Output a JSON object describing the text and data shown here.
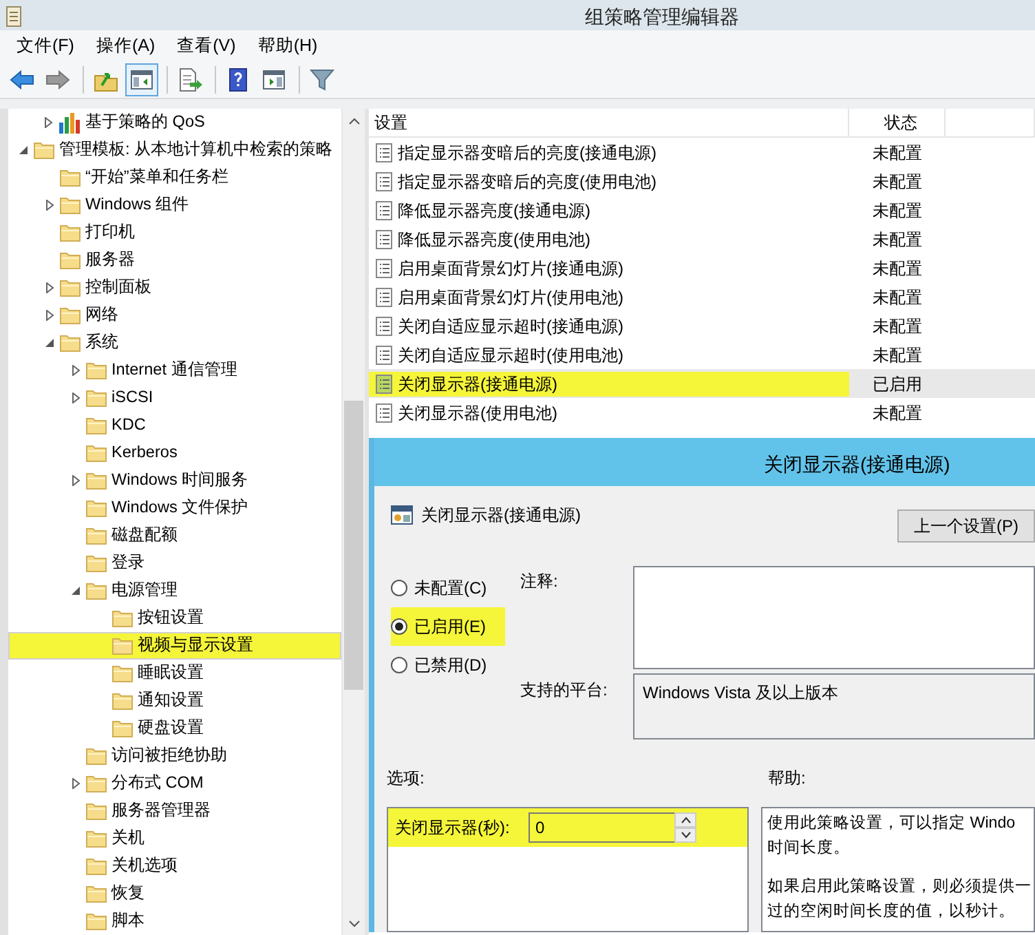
{
  "window": {
    "title": "组策略管理编辑器"
  },
  "menu": [
    "文件(F)",
    "操作(A)",
    "查看(V)",
    "帮助(H)"
  ],
  "toolbar": [
    {
      "kind": "back",
      "pressed": false
    },
    {
      "kind": "forward",
      "pressed": false
    },
    {
      "kind": "separator"
    },
    {
      "kind": "up",
      "pressed": false
    },
    {
      "kind": "tree",
      "pressed": true
    },
    {
      "kind": "separator"
    },
    {
      "kind": "export",
      "pressed": false
    },
    {
      "kind": "separator"
    },
    {
      "kind": "help",
      "pressed": false
    },
    {
      "kind": "pane",
      "pressed": false
    },
    {
      "kind": "separator"
    },
    {
      "kind": "filter",
      "pressed": false
    }
  ],
  "tree": [
    {
      "label": "基于策略的 QoS",
      "kind": "chart",
      "expanded": false,
      "selected": false,
      "highlighted": false
    },
    {
      "label": "管理模板: 从本地计算机中检索的策略",
      "kind": "folder",
      "expanded": true,
      "selected": false,
      "highlighted": false,
      "children": [
        {
          "label": "“开始”菜单和任务栏",
          "kind": "folder",
          "selected": false,
          "highlighted": false
        },
        {
          "label": "Windows 组件",
          "kind": "folder",
          "expanded": false,
          "selected": false,
          "highlighted": false
        },
        {
          "label": "打印机",
          "kind": "folder",
          "selected": false,
          "highlighted": false
        },
        {
          "label": "服务器",
          "kind": "folder",
          "selected": false,
          "highlighted": false
        },
        {
          "label": "控制面板",
          "kind": "folder",
          "expanded": false,
          "selected": false,
          "highlighted": false
        },
        {
          "label": "网络",
          "kind": "folder",
          "expanded": false,
          "selected": false,
          "highlighted": false
        },
        {
          "label": "系统",
          "kind": "folder",
          "expanded": true,
          "selected": false,
          "highlighted": false,
          "children": [
            {
              "label": "Internet 通信管理",
              "kind": "folder",
              "expanded": false,
              "selected": false,
              "highlighted": false
            },
            {
              "label": "iSCSI",
              "kind": "folder",
              "expanded": false,
              "selected": false,
              "highlighted": false
            },
            {
              "label": "KDC",
              "kind": "folder",
              "selected": false,
              "highlighted": false
            },
            {
              "label": "Kerberos",
              "kind": "folder",
              "selected": false,
              "highlighted": false
            },
            {
              "label": "Windows 时间服务",
              "kind": "folder",
              "expanded": false,
              "selected": false,
              "highlighted": false
            },
            {
              "label": "Windows 文件保护",
              "kind": "folder",
              "selected": false,
              "highlighted": false
            },
            {
              "label": "磁盘配额",
              "kind": "folder",
              "selected": false,
              "highlighted": false
            },
            {
              "label": "登录",
              "kind": "folder",
              "selected": false,
              "highlighted": false
            },
            {
              "label": "电源管理",
              "kind": "folder",
              "expanded": true,
              "selected": false,
              "highlighted": false,
              "children": [
                {
                  "label": "按钮设置",
                  "kind": "folder",
                  "selected": false,
                  "highlighted": false
                },
                {
                  "label": "视频与显示设置",
                  "kind": "folder",
                  "selected": true,
                  "highlighted": true
                },
                {
                  "label": "睡眠设置",
                  "kind": "folder",
                  "selected": false,
                  "highlighted": false
                },
                {
                  "label": "通知设置",
                  "kind": "folder",
                  "selected": false,
                  "highlighted": false
                },
                {
                  "label": "硬盘设置",
                  "kind": "folder",
                  "selected": false,
                  "highlighted": false
                }
              ]
            },
            {
              "label": "访问被拒绝协助",
              "kind": "folder",
              "selected": false,
              "highlighted": false
            },
            {
              "label": "分布式 COM",
              "kind": "folder",
              "expanded": false,
              "selected": false,
              "highlighted": false
            },
            {
              "label": "服务器管理器",
              "kind": "folder",
              "selected": false,
              "highlighted": false
            },
            {
              "label": "关机",
              "kind": "folder",
              "selected": false,
              "highlighted": false
            },
            {
              "label": "关机选项",
              "kind": "folder",
              "selected": false,
              "highlighted": false
            },
            {
              "label": "恢复",
              "kind": "folder",
              "selected": false,
              "highlighted": false
            },
            {
              "label": "脚本",
              "kind": "folder",
              "selected": false,
              "highlighted": false
            }
          ]
        }
      ]
    }
  ],
  "list": {
    "columns": [
      "设置",
      "状态"
    ],
    "rows": [
      {
        "name": "指定显示器变暗后的亮度(接通电源)",
        "status": "未配置",
        "enabled": false,
        "selected": false,
        "highlighted": false
      },
      {
        "name": "指定显示器变暗后的亮度(使用电池)",
        "status": "未配置",
        "enabled": false,
        "selected": false,
        "highlighted": false
      },
      {
        "name": "降低显示器亮度(接通电源)",
        "status": "未配置",
        "enabled": false,
        "selected": false,
        "highlighted": false
      },
      {
        "name": "降低显示器亮度(使用电池)",
        "status": "未配置",
        "enabled": false,
        "selected": false,
        "highlighted": false
      },
      {
        "name": "启用桌面背景幻灯片(接通电源)",
        "status": "未配置",
        "enabled": false,
        "selected": false,
        "highlighted": false
      },
      {
        "name": "启用桌面背景幻灯片(使用电池)",
        "status": "未配置",
        "enabled": false,
        "selected": false,
        "highlighted": false
      },
      {
        "name": "关闭自适应显示超时(接通电源)",
        "status": "未配置",
        "enabled": false,
        "selected": false,
        "highlighted": false
      },
      {
        "name": "关闭自适应显示超时(使用电池)",
        "status": "未配置",
        "enabled": false,
        "selected": false,
        "highlighted": false
      },
      {
        "name": "关闭显示器(接通电源)",
        "status": "已启用",
        "enabled": true,
        "selected": true,
        "highlighted": true
      },
      {
        "name": "关闭显示器(使用电池)",
        "status": "未配置",
        "enabled": false,
        "selected": false,
        "highlighted": false
      }
    ]
  },
  "dialog": {
    "title": "关闭显示器(接通电源)",
    "setting_name": "关闭显示器(接通电源)",
    "prev_button": "上一个设置(P)",
    "radios": [
      {
        "label": "未配置(C)",
        "selected": false,
        "highlighted": false
      },
      {
        "label": "已启用(E)",
        "selected": true,
        "highlighted": true
      },
      {
        "label": "已禁用(D)",
        "selected": false,
        "highlighted": false
      }
    ],
    "comment_label": "注释:",
    "platform_label": "支持的平台:",
    "platform": "Windows Vista 及以上版本",
    "options_label": "选项:",
    "help_label": "帮助:",
    "option": {
      "label": "关闭显示器(秒):",
      "value": "0",
      "highlighted": true
    },
    "help": [
      [
        "使用此策略设置，可以指定 Windo",
        "时间长度。"
      ],
      [
        "如果启用此策略设置，则必须提供一",
        "过的空闲时间长度的值，以秒计。"
      ]
    ]
  }
}
